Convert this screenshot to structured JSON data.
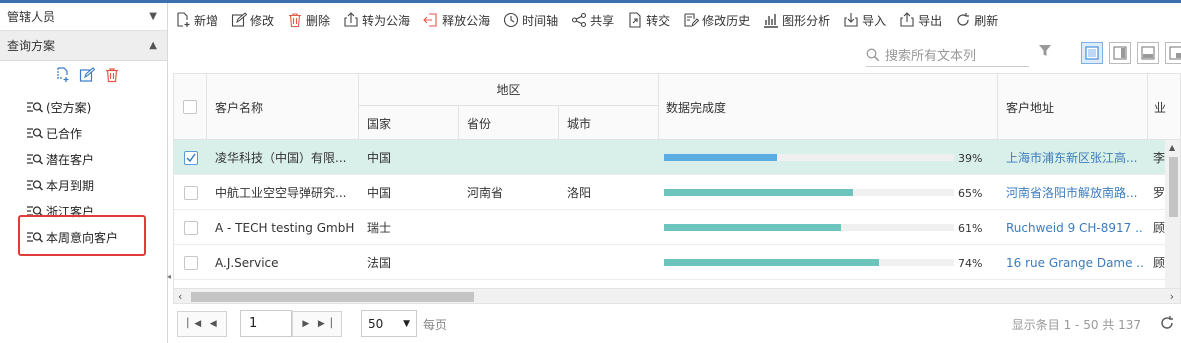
{
  "sidebar": {
    "header_label": "管辖人员",
    "section_label": "查询方案",
    "plans": [
      "(空方案)",
      "已合作",
      "潜在客户",
      "本月到期",
      "浙江客户",
      "本周意向客户"
    ]
  },
  "toolbar": {
    "buttons": [
      "新增",
      "修改",
      "删除",
      "转为公海",
      "释放公海",
      "时间轴",
      "共享",
      "转交",
      "修改历史",
      "图形分析",
      "导入",
      "导出",
      "刷新"
    ]
  },
  "search": {
    "placeholder": "搜索所有文本列"
  },
  "table": {
    "headers": {
      "name": "客户名称",
      "region": "地区",
      "country": "国家",
      "province": "省份",
      "city": "城市",
      "completion": "数据完成度",
      "address": "客户地址",
      "next": "业"
    },
    "rows": [
      {
        "name": "凌华科技（中国）有限...",
        "country": "中国",
        "province": "",
        "city": "",
        "pct_label": "39%",
        "pct": 39,
        "color": "#5aaee3",
        "address": "上海市浦东新区张江高...",
        "next": "李",
        "selected": true
      },
      {
        "name": "中航工业空空导弹研究...",
        "country": "中国",
        "province": "河南省",
        "city": "洛阳",
        "pct_label": "65%",
        "pct": 65,
        "color": "#6dc4bc",
        "address": "河南省洛阳市解放南路...",
        "next": "罗",
        "selected": false
      },
      {
        "name": "A - TECH testing GmbH",
        "country": "瑞士",
        "province": "",
        "city": "",
        "pct_label": "61%",
        "pct": 61,
        "color": "#6dc4bc",
        "address": "Ruchweid 9 CH-8917 ...",
        "next": "顾",
        "selected": false
      },
      {
        "name": "A.J.Service",
        "country": "法国",
        "province": "",
        "city": "",
        "pct_label": "74%",
        "pct": 74,
        "color": "#6dc4bc",
        "address": "16 rue Grange Dame ...",
        "next": "顾",
        "selected": false
      }
    ]
  },
  "pager": {
    "page": "1",
    "page_size": "50",
    "per_page_label": "每页",
    "info": "显示条目 1 - 50 共 137"
  },
  "colors": {
    "accent": "#3a6fb0",
    "selected_row": "#d9efea",
    "highlight": "#e23a3a",
    "link": "#3c7cbf"
  }
}
